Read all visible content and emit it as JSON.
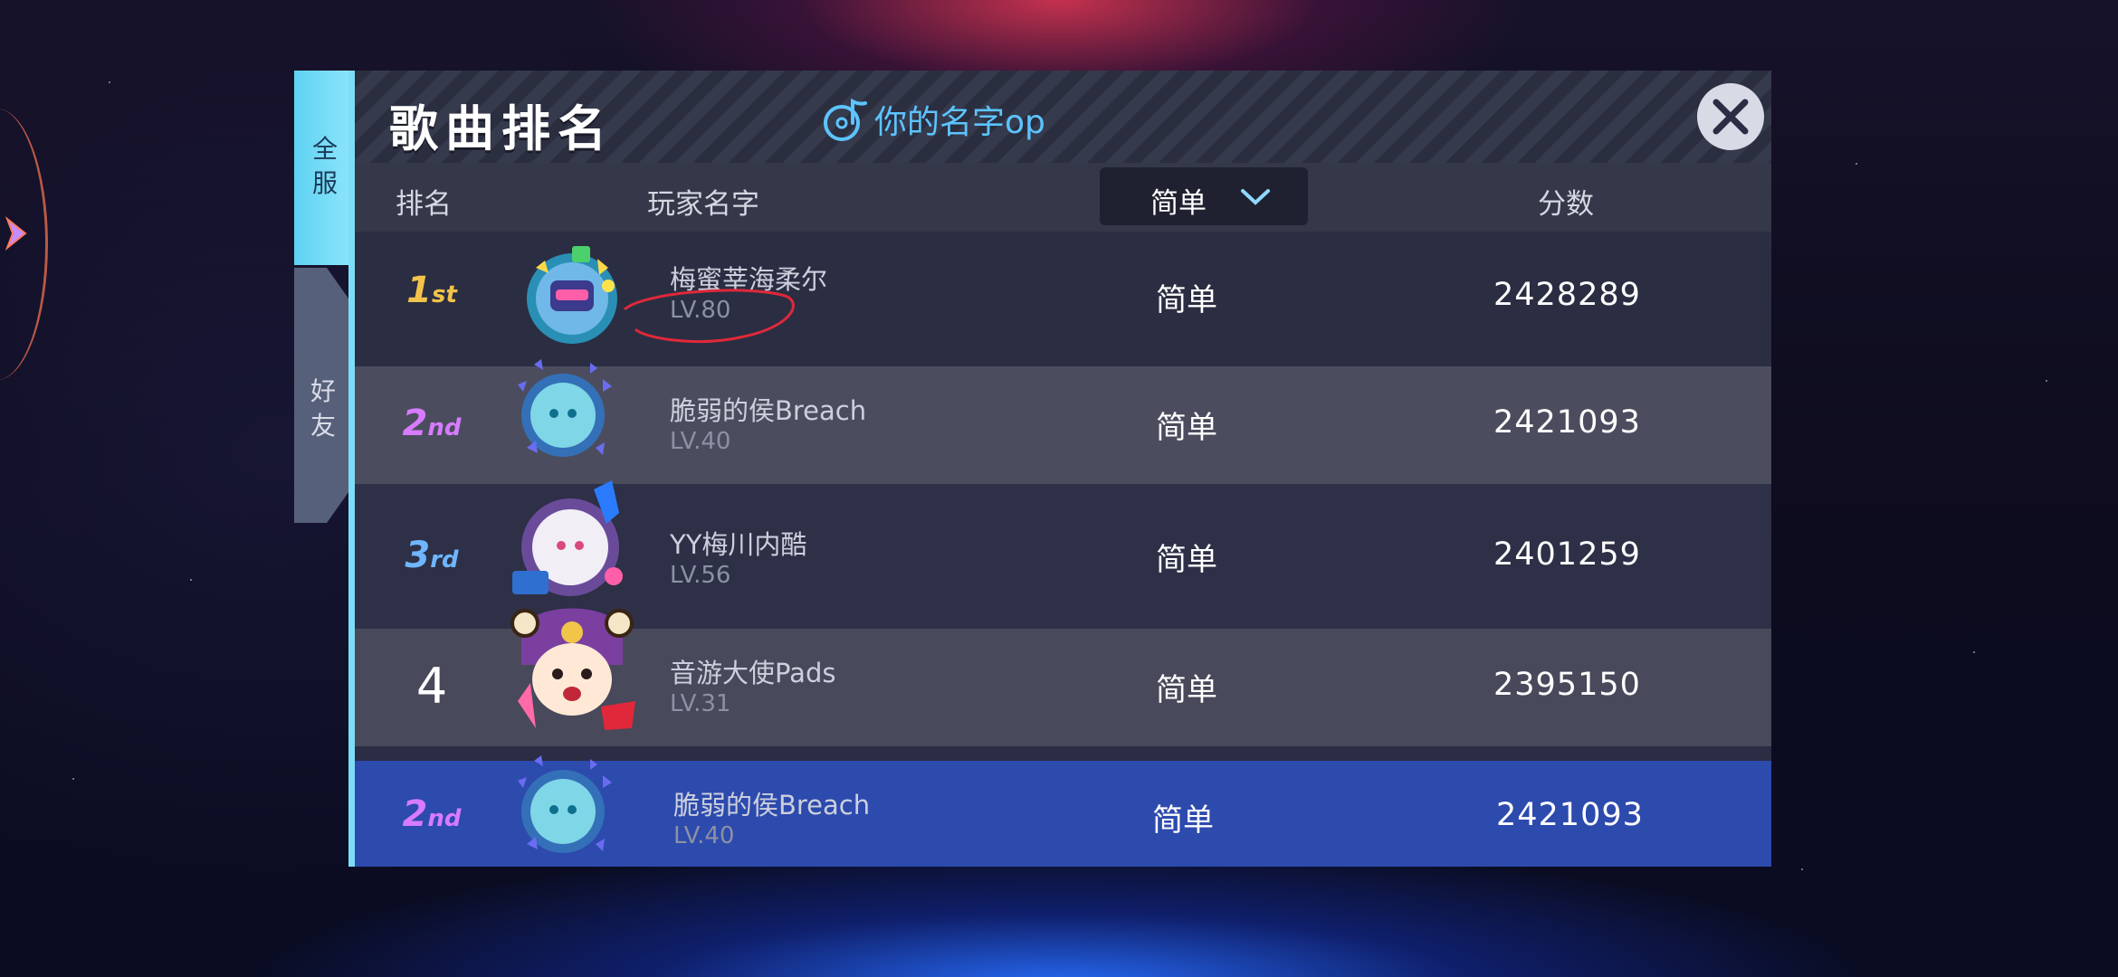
{
  "tabs": {
    "all": "全服",
    "friends": "好友"
  },
  "header": {
    "title": "歌曲排名",
    "song_name": "你的名字op"
  },
  "columns": {
    "rank": "排名",
    "player": "玩家名字",
    "difficulty_selected": "简单",
    "score": "分数"
  },
  "rows": [
    {
      "rank_num": "1",
      "rank_suffix": "st",
      "name": "梅蜜莘海柔尔",
      "level": "LV.80",
      "difficulty": "简单",
      "score": "2428289",
      "rank_color": "#f2c24a"
    },
    {
      "rank_num": "2",
      "rank_suffix": "nd",
      "name": "脆弱的侯Breach",
      "level": "LV.40",
      "difficulty": "简单",
      "score": "2421093",
      "rank_color": "#d77bff"
    },
    {
      "rank_num": "3",
      "rank_suffix": "rd",
      "name": "YY梅川内酷",
      "level": "LV.56",
      "difficulty": "简单",
      "score": "2401259",
      "rank_color": "#6fb6ff"
    },
    {
      "rank_num": "4",
      "rank_suffix": "",
      "name": "音游大使Pads",
      "level": "LV.31",
      "difficulty": "简单",
      "score": "2395150",
      "rank_color": "#ffffff"
    }
  ],
  "self_row": {
    "rank_num": "2",
    "rank_suffix": "nd",
    "name": "脆弱的侯Breach",
    "level": "LV.40",
    "difficulty": "简单",
    "score": "2421093",
    "rank_color": "#d77bff"
  },
  "colors": {
    "accent_tab": "#7fdcf7",
    "self_row_bg": "#2d4aad",
    "song_name": "#5cc4ff",
    "annotation": "#e0283a"
  },
  "icons": {
    "song": "music-note-disc-icon",
    "close": "close-icon",
    "dropdown": "chevron-down-icon"
  }
}
